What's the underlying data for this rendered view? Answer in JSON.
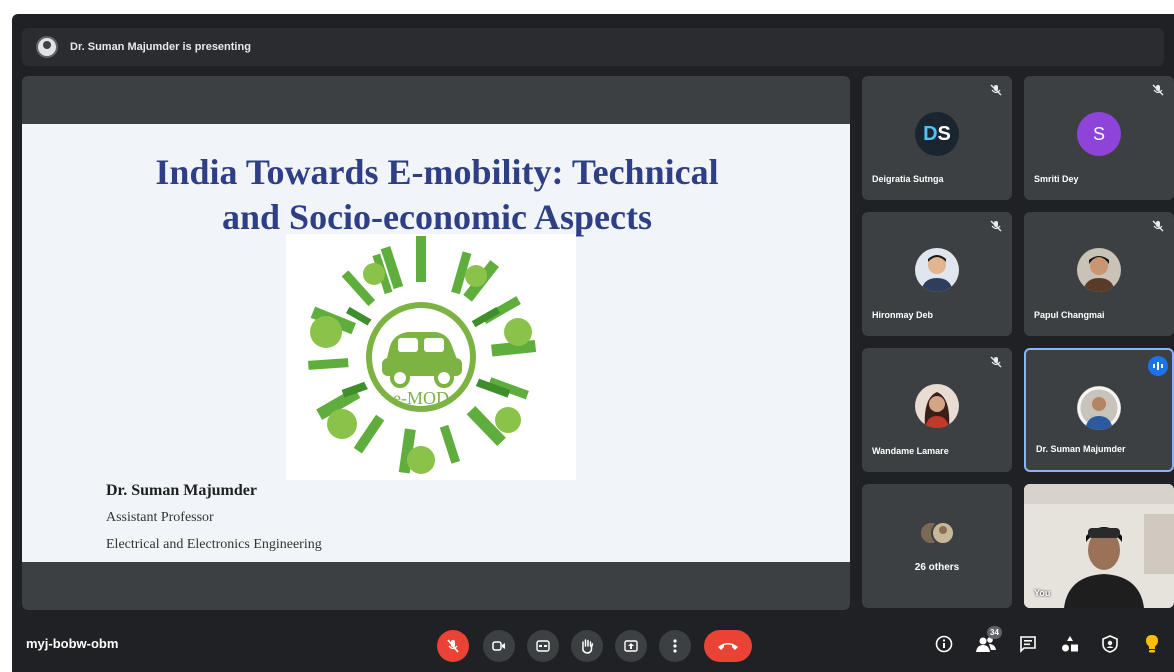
{
  "presenter_bar": {
    "text": "Dr. Suman Majumder is presenting"
  },
  "slide": {
    "title_line1": "India Towards E-mobility: Technical",
    "title_line2": "and Socio-economic Aspects",
    "logo_text": "e-MOD",
    "presenter_name": "Dr. Suman Majumder",
    "presenter_title": "Assistant Professor",
    "presenter_department": "Electrical and Electronics Engineering"
  },
  "participants": [
    {
      "name": "Deigratia Sutnga",
      "avatar": "DS",
      "avatar_type": "logo",
      "muted": true
    },
    {
      "name": "Smriti Dey",
      "avatar": "S",
      "avatar_type": "letter",
      "muted": true
    },
    {
      "name": "Hironmay Deb",
      "avatar_type": "photo",
      "muted": true
    },
    {
      "name": "Papul Changmai",
      "avatar_type": "photo",
      "muted": true
    },
    {
      "name": "Wandame Lamare",
      "avatar_type": "photo",
      "muted": true
    },
    {
      "name": "Dr. Suman Majumder",
      "avatar_type": "photo",
      "speaking": true
    }
  ],
  "others": {
    "label": "26 others"
  },
  "self_view": {
    "label": "You"
  },
  "meeting_code": "myj-bobw-obm",
  "people_count": "34",
  "colors": {
    "background": "#202124",
    "tile": "#3c4043",
    "red": "#ea4335",
    "accent": "#1a73e8",
    "slide_title": "#2e3f86"
  },
  "icons": {
    "controls": [
      "mic-off-icon",
      "camera-icon",
      "captions-icon",
      "raise-hand-icon",
      "present-icon",
      "more-icon",
      "end-call-icon"
    ],
    "right": [
      "info-icon",
      "people-icon",
      "chat-icon",
      "activities-icon",
      "host-controls-icon",
      "lightbulb-icon"
    ]
  }
}
